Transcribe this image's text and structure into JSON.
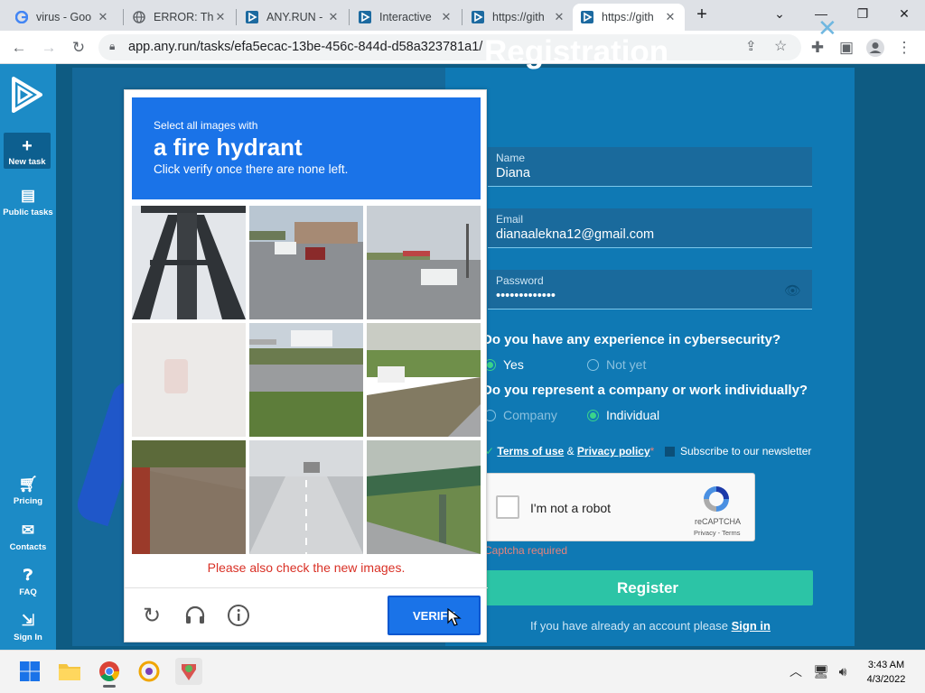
{
  "tabs": [
    {
      "title": "virus - Goo",
      "icon": "google-icon"
    },
    {
      "title": "ERROR: The",
      "icon": "globe-icon"
    },
    {
      "title": "ANY.RUN -",
      "icon": "anyrun-icon"
    },
    {
      "title": "Interactive",
      "icon": "anyrun-icon"
    },
    {
      "title": "https://gith",
      "icon": "anyrun-icon"
    },
    {
      "title": "https://gith",
      "icon": "anyrun-icon",
      "active": true
    }
  ],
  "toolbar": {
    "url": "app.any.run/tasks/efa5ecac-13be-456c-844d-d58a323781a1/"
  },
  "leftnav": {
    "new_task": "New task",
    "public_tasks": "Public tasks",
    "pricing": "Pricing",
    "contacts": "Contacts",
    "faq": "FAQ",
    "sign_in": "Sign In"
  },
  "challenge": {
    "line1": "Select all images with",
    "line2": "a fire hydrant",
    "line3": "Click verify once there are none left.",
    "error": "Please also check the new images.",
    "verify_label": "VERIFY"
  },
  "registration": {
    "title": "Registration",
    "name_label": "Name",
    "name_value": "Diana",
    "email_label": "Email",
    "email_value": "dianaalekna12@gmail.com",
    "password_label": "Password",
    "password_value": "•••••••••••••",
    "q1": "Do you have any experience in cybersecurity?",
    "q1_yes": "Yes",
    "q1_no": "Not yet",
    "q2": "Do you represent a company or work individually?",
    "q2_company": "Company",
    "q2_individual": "Individual",
    "terms": "Terms of use",
    "amp": "&",
    "privacy": "Privacy policy",
    "asterisk": "*",
    "newsletter": "Subscribe to our newsletter",
    "recaptcha_text": "I'm not a robot",
    "recaptcha_brand": "reCAPTCHA",
    "recaptcha_links": "Privacy - Terms",
    "captcha_error": "Captcha required",
    "register_label": "Register",
    "signin_text": "If you have already an account please",
    "signin_link": "Sign in"
  },
  "clock": {
    "time": "3:43 AM",
    "date": "4/3/2022"
  },
  "colors": {
    "accent": "#1a73e8",
    "page_bg": "#0f79b4",
    "register": "#2cc4a6"
  }
}
